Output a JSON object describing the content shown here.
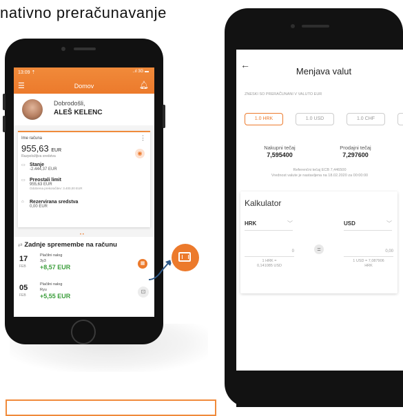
{
  "heading": "nativno preračunavanje",
  "phone1": {
    "status_time": "13:09 ⇡",
    "status_right": "..ıl 3G ▬",
    "title": "Domov",
    "welcome": "Dobrodošli,",
    "user": "ALEŠ KELENC",
    "account": {
      "name": "Ime računa",
      "amount": "955,63",
      "currency": "EUR",
      "available_label": "Razpoložljiva sredstva",
      "rows": [
        {
          "label": "Stanje",
          "value": "-2.444,37 EUR",
          "note": ""
        },
        {
          "label": "Preostali limit",
          "value": "955,63 EUR",
          "note": "Odobrena prekoračitev: 3.400,00 EUR"
        },
        {
          "label": "Rezervirana sredstva",
          "value": "0,00 EUR",
          "note": ""
        }
      ]
    },
    "changes_title": "Zadnje spremembe na računu",
    "transactions": [
      {
        "day": "17",
        "month": "FEB",
        "type": "Plačilni nalog",
        "sub": "3y3",
        "amount": "+8,57 EUR"
      },
      {
        "day": "05",
        "month": "FEB",
        "type": "Plačilni nalog",
        "sub": "Ryu",
        "amount": "+5,55 EUR"
      }
    ]
  },
  "phone2": {
    "title": "Menjava valut",
    "note": "ZNESKI SO PRERAČUNANI V VALUTO EUR",
    "chips": [
      "1.0 HRK",
      "1.0 USD",
      "1.0 CHF"
    ],
    "buy_label": "Nakupni tečaj",
    "buy_value": "7,595400",
    "sell_label": "Prodajni tečaj",
    "sell_value": "7,297600",
    "ref_line1": "Referenčni tečaj ECB 7,446500",
    "ref_line2": "Vrednost valute je nastavljena na 18.02.2020 za 00:00:00",
    "calc_title": "Kalkulator",
    "from_currency": "HRK",
    "to_currency": "USD",
    "from_value": "0",
    "to_value": "0,00",
    "from_rate_1": "1 HRK =",
    "from_rate_2": "0,141085 USD",
    "to_rate_1": "1 USD = 7,087906",
    "to_rate_2": "HRK"
  },
  "colors": {
    "accent": "#ec7a2c",
    "positive": "#3a9d3a"
  }
}
